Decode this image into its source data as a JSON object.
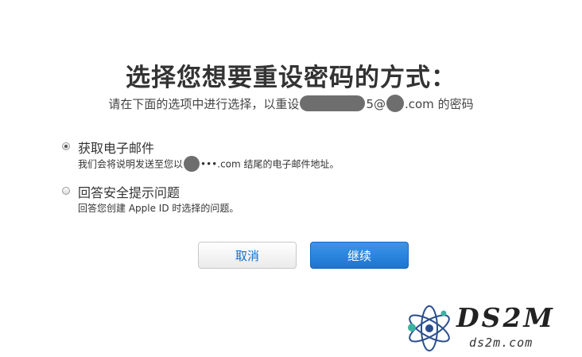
{
  "page": {
    "title": "选择您想要重设密码的方式：",
    "subtitle_prefix": "请在下面的选项中进行选择，以重设",
    "subtitle_masked_fragment": "5@",
    "subtitle_domain": ".com",
    "subtitle_suffix": " 的密码"
  },
  "options": [
    {
      "label": "获取电子邮件",
      "checked": true,
      "desc_prefix": "我们会将说明发送至您以",
      "desc_masked": "•••.com",
      "desc_suffix": " 结尾的电子邮件地址。"
    },
    {
      "label": "回答安全提示问题",
      "checked": false,
      "desc": "回答您创建 Apple ID 时选择的问题。"
    }
  ],
  "buttons": {
    "cancel_label": "取消",
    "continue_label": "继续"
  },
  "watermark": {
    "brand": "DS2M",
    "domain": "ds2m.com"
  },
  "colors": {
    "primary_button": "#1b75d3",
    "cancel_text": "#0a6fcf"
  }
}
